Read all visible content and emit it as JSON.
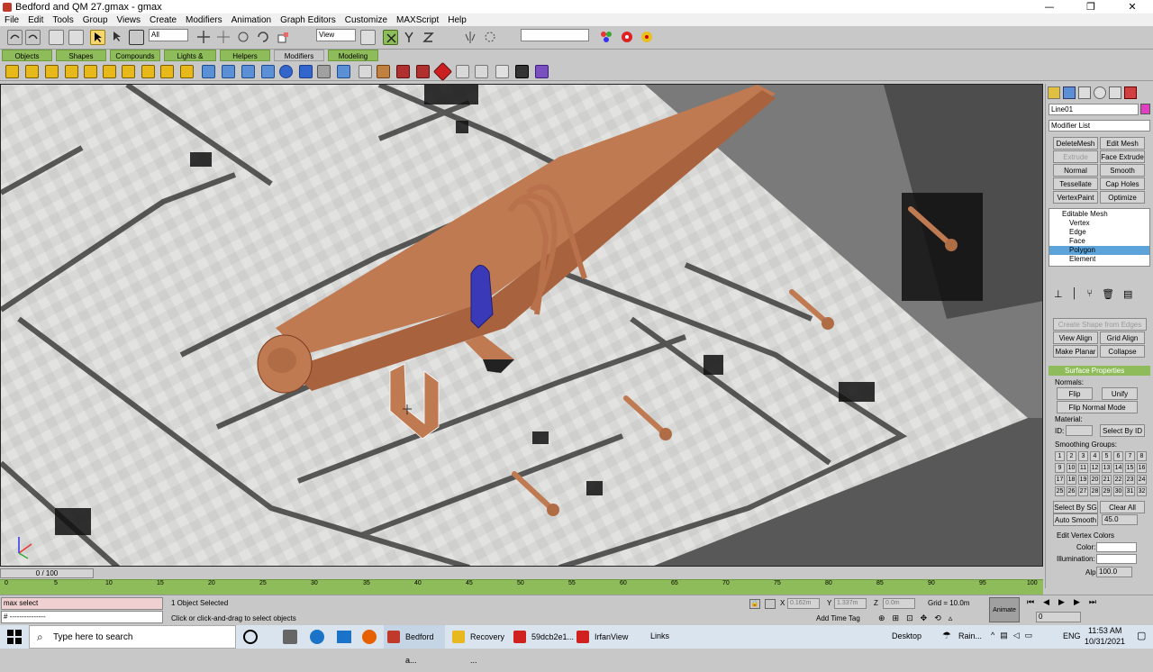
{
  "window": {
    "title": "Bedford and QM 27.gmax - gmax",
    "minimize": "—",
    "restore": "❐",
    "close": "✕"
  },
  "menu": [
    "File",
    "Edit",
    "Tools",
    "Group",
    "Views",
    "Create",
    "Modifiers",
    "Animation",
    "Graph Editors",
    "Customize",
    "MAXScript",
    "Help"
  ],
  "toolbar": {
    "selection_filter": "All",
    "ref_coord": "View"
  },
  "tabs": [
    "Objects",
    "Shapes",
    "Compounds",
    "Lights & Cameras",
    "Helpers",
    "Modifiers",
    "Modeling"
  ],
  "active_tab": "Modifiers",
  "command_panel": {
    "object_name": "Line01",
    "object_color": "#e040c0",
    "modifier_list": "Modifier List",
    "buttons": [
      "DeleteMesh",
      "Edit Mesh",
      "Extrude",
      "Face Extrude",
      "Normal",
      "Smooth",
      "Tessellate",
      "Cap Holes",
      "VertexPaint",
      "Optimize"
    ],
    "stack": {
      "root": "Editable Mesh",
      "items": [
        "Vertex",
        "Edge",
        "Face",
        "Polygon",
        "Element"
      ],
      "selected": "Polygon"
    },
    "geom_buttons": [
      "Create Shape from Edges",
      "View Align",
      "Grid Align",
      "Make Planar",
      "Collapse"
    ],
    "surface_title": "Surface Properties",
    "normals_label": "Normals:",
    "flip": "Flip",
    "unify": "Unify",
    "flip_normal_mode": "Flip Normal Mode",
    "material_label": "Material:",
    "id_label": "ID:",
    "select_by_id": "Select By ID",
    "smoothing_label": "Smoothing Groups:",
    "sg": [
      "1",
      "2",
      "3",
      "4",
      "5",
      "6",
      "7",
      "8",
      "9",
      "10",
      "11",
      "12",
      "13",
      "14",
      "15",
      "16",
      "17",
      "18",
      "19",
      "20",
      "21",
      "22",
      "23",
      "24",
      "25",
      "26",
      "27",
      "28",
      "29",
      "30",
      "31",
      "32"
    ],
    "select_by_sg": "Select By SG",
    "clear_all": "Clear All",
    "auto_smooth": "Auto Smooth",
    "auto_smooth_value": "45.0",
    "vertex_colors_label": "Edit Vertex Colors",
    "color_label": "Color:",
    "illum_label": "Illumination:",
    "alpha_label": "Alpha:",
    "alpha_value": "100.0"
  },
  "timeline": {
    "frame_display": "0 / 100",
    "ticks": [
      "0",
      "5",
      "10",
      "15",
      "20",
      "25",
      "30",
      "35",
      "40",
      "45",
      "50",
      "55",
      "60",
      "65",
      "70",
      "75",
      "80",
      "85",
      "90",
      "95",
      "100"
    ]
  },
  "status": {
    "script_line": "max select",
    "script_line2": "# ---------------",
    "selected": "1 Object Selected",
    "prompt": "Click or click-and-drag to select objects",
    "x": "0.162m",
    "y": "1.337m",
    "z": "0.0m",
    "grid": "Grid = 10.0m",
    "add_time_tag": "Add Time Tag",
    "animate": "Animate",
    "frame": "0"
  },
  "taskbar": {
    "search": "Type here to search",
    "apps": [
      "Bedford a...",
      "Recovery ...",
      "59dcb2e1...",
      "IrfanView"
    ],
    "links": "Links",
    "desktop": "Desktop",
    "weather": "Rain...",
    "lang": "ENG",
    "time": "11:53 AM",
    "date": "10/31/2021"
  }
}
